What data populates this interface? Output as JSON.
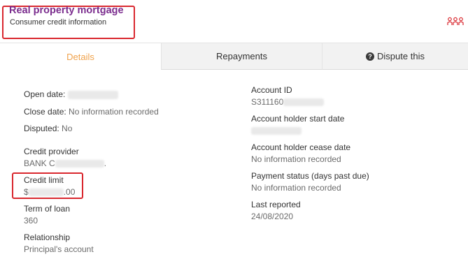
{
  "header": {
    "title": "Real property mortgage",
    "subtitle": "Consumer credit information",
    "people_icon": "people-group-icon",
    "accent_color": "#7b2d8e",
    "highlight_color": "#d9272e"
  },
  "tabs": [
    {
      "label": "Details",
      "active": true
    },
    {
      "label": "Repayments",
      "active": false
    },
    {
      "label": "Dispute this",
      "active": false,
      "icon": "question-circle-icon"
    }
  ],
  "details": {
    "open_date": {
      "label": "Open date:",
      "value": ""
    },
    "close_date": {
      "label": "Close date:",
      "value": "No information recorded"
    },
    "disputed": {
      "label": "Disputed:",
      "value": "No"
    },
    "credit_provider": {
      "label": "Credit provider",
      "value_prefix": "BANK C",
      "value_suffix": "."
    },
    "credit_limit": {
      "label": "Credit limit",
      "value_prefix": "$",
      "value_suffix": ".00"
    },
    "term_of_loan": {
      "label": "Term of loan",
      "value": "360"
    },
    "relationship": {
      "label": "Relationship",
      "value": "Principal's account"
    },
    "account_id": {
      "label": "Account ID",
      "value_prefix": "S311160"
    },
    "account_holder_start_date": {
      "label": "Account holder start date",
      "value": ""
    },
    "account_holder_cease_date": {
      "label": "Account holder cease date",
      "value": "No information recorded"
    },
    "payment_status": {
      "label": "Payment status (days past due)",
      "value": "No information recorded"
    },
    "last_reported": {
      "label": "Last reported",
      "value": "24/08/2020"
    }
  }
}
